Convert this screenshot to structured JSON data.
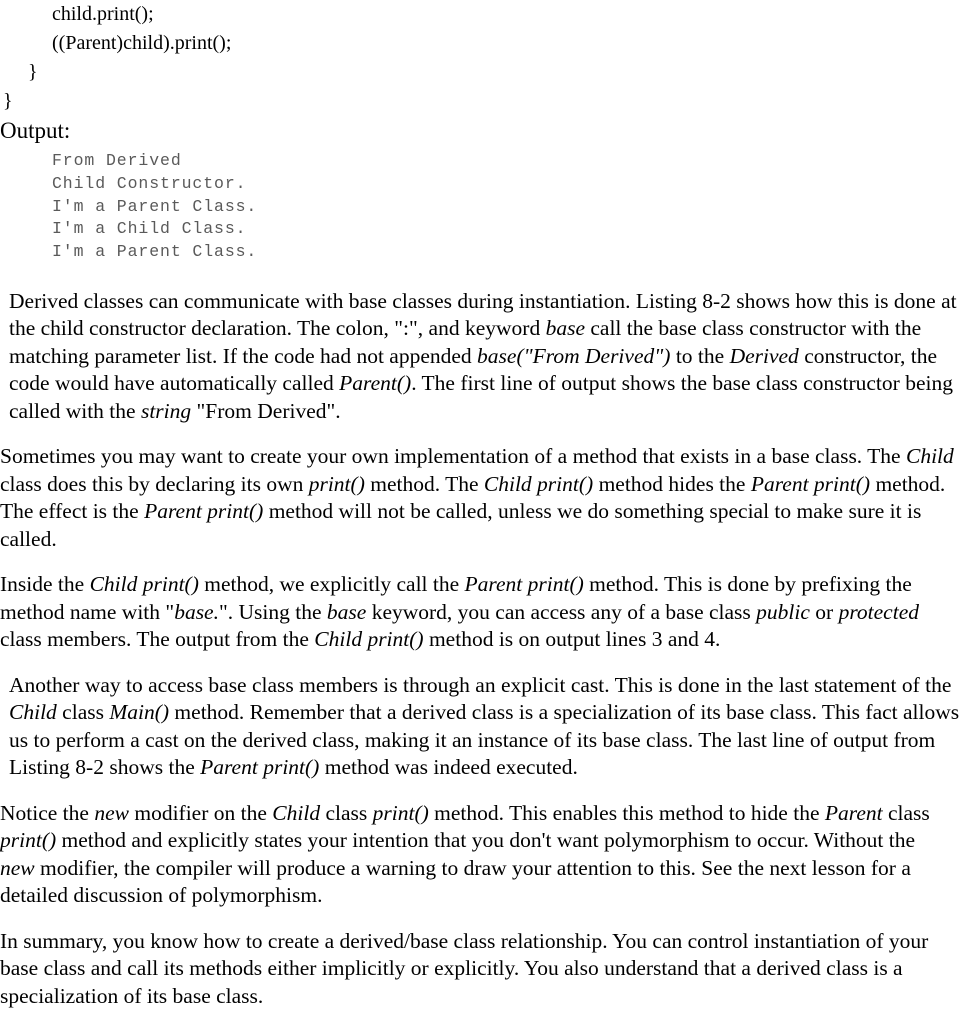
{
  "code_listing": {
    "lines": [
      {
        "text": "child.print();",
        "indent": "lvl2"
      },
      {
        "text": "((Parent)child).print();",
        "indent": "lvl2"
      },
      {
        "text": "}",
        "indent": "lvl1"
      },
      {
        "text": "}",
        "indent": "lvl0"
      }
    ]
  },
  "output": {
    "label": "Output:",
    "lines": [
      "From Derived",
      "Child Constructor.",
      "I'm a Parent Class.",
      "I'm a Child Class.",
      "I'm a Parent Class."
    ]
  },
  "paragraphs": {
    "p1": {
      "segments": [
        {
          "text": "Derived classes can communicate with base classes during instantiation. Listing 8-2 shows how this is done at the child constructor declaration. The colon, \":\", and keyword ",
          "style": "normal"
        },
        {
          "text": "base",
          "style": "italic"
        },
        {
          "text": " call the base class constructor with the matching parameter list. If the code had not appended ",
          "style": "normal"
        },
        {
          "text": "base(\"From Derived\")",
          "style": "italic"
        },
        {
          "text": " to the ",
          "style": "normal"
        },
        {
          "text": "Derived",
          "style": "italic"
        },
        {
          "text": " constructor, the code would have automatically called ",
          "style": "normal"
        },
        {
          "text": "Parent()",
          "style": "italic"
        },
        {
          "text": ". The first line of output shows the base class constructor being called with the ",
          "style": "normal"
        },
        {
          "text": "string",
          "style": "italic"
        },
        {
          "text": " \"From Derived\".",
          "style": "normal"
        }
      ]
    },
    "p2": {
      "segments": [
        {
          "text": "Sometimes you may want to create your own implementation of a method that exists in a base class. The ",
          "style": "normal"
        },
        {
          "text": "Child",
          "style": "italic"
        },
        {
          "text": " class does this by declaring its own ",
          "style": "normal"
        },
        {
          "text": "print()",
          "style": "italic"
        },
        {
          "text": " method. The ",
          "style": "normal"
        },
        {
          "text": "Child print()",
          "style": "italic"
        },
        {
          "text": " method hides the ",
          "style": "normal"
        },
        {
          "text": "Parent print()",
          "style": "italic"
        },
        {
          "text": " method. The effect is the ",
          "style": "normal"
        },
        {
          "text": "Parent print()",
          "style": "italic"
        },
        {
          "text": " method will not be called, unless we do something special to make sure it is called.",
          "style": "normal"
        }
      ]
    },
    "p3": {
      "segments": [
        {
          "text": "Inside the ",
          "style": "normal"
        },
        {
          "text": "Child print()",
          "style": "italic"
        },
        {
          "text": " method, we explicitly call the ",
          "style": "normal"
        },
        {
          "text": "Parent print()",
          "style": "italic"
        },
        {
          "text": " method. This is done by prefixing the method name with \"",
          "style": "normal"
        },
        {
          "text": "base.",
          "style": "italic"
        },
        {
          "text": "\". Using the ",
          "style": "normal"
        },
        {
          "text": "base",
          "style": "italic"
        },
        {
          "text": " keyword, you can access any of a base class ",
          "style": "normal"
        },
        {
          "text": "public",
          "style": "italic"
        },
        {
          "text": " or ",
          "style": "normal"
        },
        {
          "text": "protected",
          "style": "italic"
        },
        {
          "text": " class members. The output from the ",
          "style": "normal"
        },
        {
          "text": "Child print()",
          "style": "italic"
        },
        {
          "text": " method is on output lines 3 and 4.",
          "style": "normal"
        }
      ]
    },
    "p4": {
      "segments": [
        {
          "text": "Another way to access base class members is through an explicit cast. This is done in the last statement of the ",
          "style": "normal"
        },
        {
          "text": "Child",
          "style": "italic"
        },
        {
          "text": " class ",
          "style": "normal"
        },
        {
          "text": "Main()",
          "style": "italic"
        },
        {
          "text": " method. Remember that a derived class is a specialization of its base class. This fact allows us to perform a cast on the derived class, making it an instance of its base class. The last line of output from Listing 8-2 shows the ",
          "style": "normal"
        },
        {
          "text": "Parent print()",
          "style": "italic"
        },
        {
          "text": " method was indeed executed.",
          "style": "normal"
        }
      ]
    },
    "p5": {
      "segments": [
        {
          "text": "Notice the ",
          "style": "normal"
        },
        {
          "text": "new",
          "style": "italic"
        },
        {
          "text": " modifier on the ",
          "style": "normal"
        },
        {
          "text": "Child",
          "style": "italic"
        },
        {
          "text": " class ",
          "style": "normal"
        },
        {
          "text": "print()",
          "style": "italic"
        },
        {
          "text": " method. This enables this method to hide the ",
          "style": "normal"
        },
        {
          "text": "Parent",
          "style": "italic"
        },
        {
          "text": " class ",
          "style": "normal"
        },
        {
          "text": "print()",
          "style": "italic"
        },
        {
          "text": " method and explicitly states your intention that you don't want polymorphism to occur. Without the ",
          "style": "normal"
        },
        {
          "text": "new",
          "style": "italic"
        },
        {
          "text": " modifier, the compiler will produce a warning to draw your attention to this. See the next lesson for a detailed discussion of polymorphism.",
          "style": "normal"
        }
      ]
    },
    "p6": {
      "segments": [
        {
          "text": "In summary, you know how to create a derived/base class relationship. You can control instantiation of your base class and call its methods either implicitly or explicitly. You also understand that a derived class is a specialization of its base class.",
          "style": "normal"
        }
      ]
    }
  },
  "colors": {
    "body_text": "#000000",
    "console_text": "#5a5a5a",
    "page_background": "#ffffff"
  }
}
